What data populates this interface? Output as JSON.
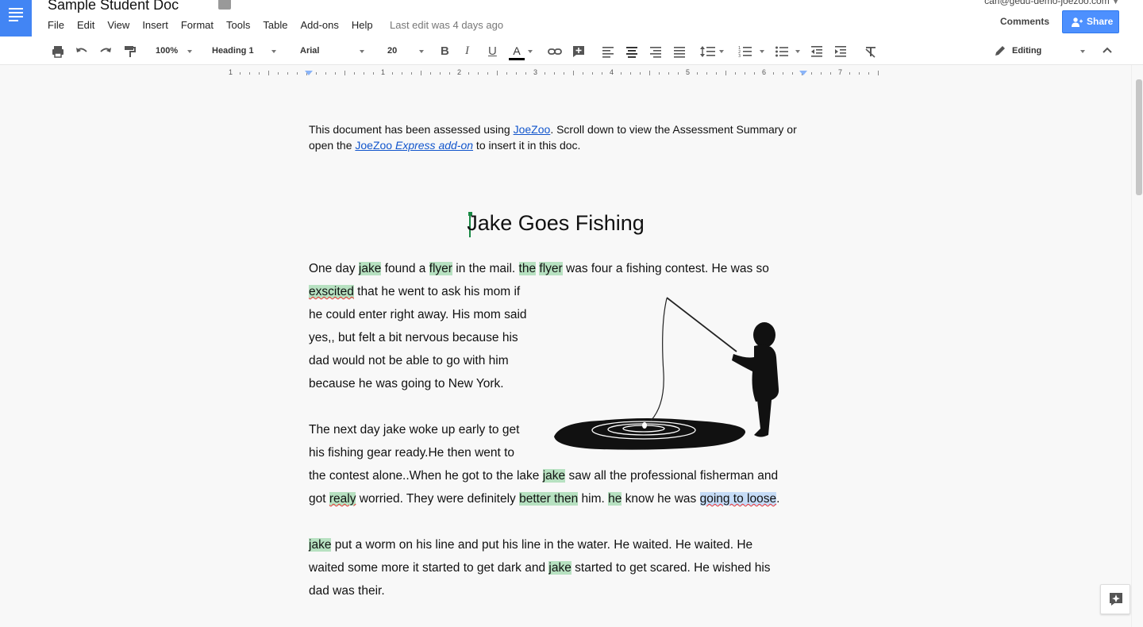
{
  "header": {
    "title": "Sample Student Doc",
    "menu": [
      "File",
      "Edit",
      "View",
      "Insert",
      "Format",
      "Tools",
      "Table",
      "Add-ons",
      "Help"
    ],
    "last_edit": "Last edit was 4 days ago",
    "account": "carl@gedu-demo-joezoo.com",
    "comments_label": "Comments",
    "share_label": "Share"
  },
  "toolbar": {
    "zoom": "100%",
    "style": "Heading 1",
    "font": "Arial",
    "size": "20",
    "mode": "Editing",
    "font_color_label": "A"
  },
  "ruler": {
    "numbers": [
      "1",
      "1",
      "2",
      "3",
      "4",
      "5",
      "6",
      "7"
    ]
  },
  "document": {
    "notice": {
      "before": "This document has been assessed using ",
      "link1": "JoeZoo",
      "middle": ". Scroll down to view the Assessment Summary or open the ",
      "link2_a": "JoeZoo ",
      "link2_b": "Express add-on",
      "after": " to insert it in this doc."
    },
    "heading": "Jake Goes Fishing",
    "p1": {
      "l1a": "One day ",
      "jake": "jake",
      "l1b": " found a ",
      "flyer": "flyer",
      "l1c": " in the mail. ",
      "the": "the",
      "l1d": " ",
      "flyer2": "flyer",
      "l1e": " was four a fishing contest. He was so",
      "exscited": "exscited",
      "l2b": " that he went to ask his mom if",
      "l3": "he could enter right away. His mom said",
      "l4": "yes,, but felt a bit nervous because his",
      "l5": "dad would not be able to go with him",
      "l6": "because he was going to New York."
    },
    "p2": {
      "l1": "The next day jake woke up early to get",
      "l2": "his fishing gear ready.He then went to",
      "l3a": "the contest alone..When he got to the lake ",
      "jake": "jake",
      "l3b": " saw all the professional fisherman and",
      "l4a": "got ",
      "realy": "realy",
      "l4b": " worried.  They were definitely ",
      "better_then": "better then",
      "l4c": " him.  ",
      "he": "he",
      "l4d": " know he was ",
      "going": "going to loose",
      "l4e": "."
    },
    "p3": {
      "jake": "jake",
      "l1b": " put a worm on his line and put his line in the water. He waited. He waited. He",
      "l2a": "waited some more it started to get dark and ",
      "jake2": "jake",
      "l2b": " started to get scared. He wished his",
      "l3": "dad was their."
    }
  }
}
